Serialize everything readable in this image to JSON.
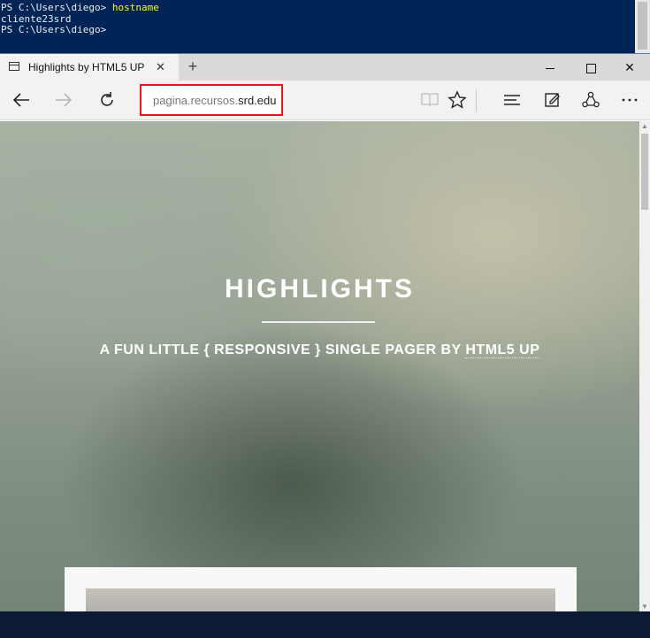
{
  "console": {
    "line1_prompt": "PS C:\\Users\\diego> ",
    "line1_cmd": "hostname",
    "line2": "cliente23srd",
    "line3": "PS C:\\Users\\diego>"
  },
  "browser": {
    "tab_title": "Highlights by HTML5 UP",
    "tab_close": "✕",
    "new_tab": "+",
    "window_close": "✕",
    "address_plain": "pagina.recursos.",
    "address_domain": "srd.edu",
    "icons": {
      "back": "back-arrow-icon",
      "forward": "forward-arrow-icon",
      "refresh": "refresh-icon",
      "reading_view": "reading-view-icon",
      "favorite": "star-icon",
      "hub": "hub-icon",
      "web_note": "web-note-icon",
      "share": "share-icon",
      "more": "more-icon"
    }
  },
  "page": {
    "title": "HIGHLIGHTS",
    "subtitle_text": "A FUN LITTLE { RESPONSIVE } SINGLE PAGER BY ",
    "subtitle_link": "HTML5 UP"
  },
  "colors": {
    "console_bg": "#012456",
    "address_highlight": "#e0171d"
  }
}
